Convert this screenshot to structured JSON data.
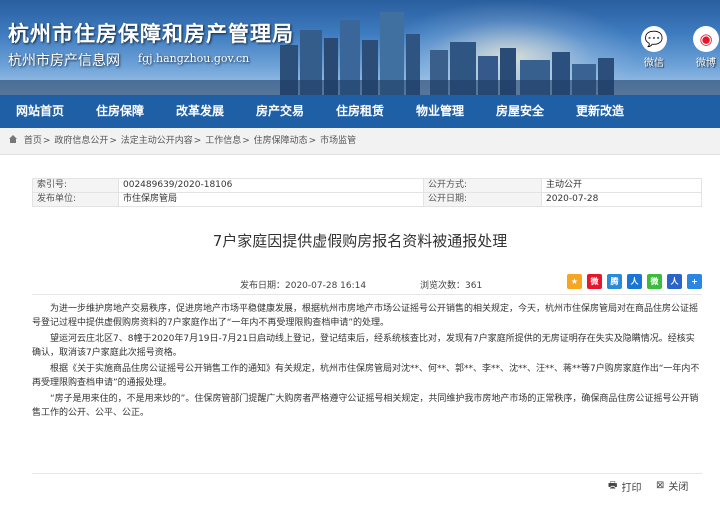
{
  "header": {
    "title": "杭州市住房保障和房产管理局",
    "subtitle": "杭州市房产信息网",
    "url": "fgj.hangzhou.gov.cn",
    "social": [
      {
        "label": "微信",
        "icon": "wechat-icon"
      },
      {
        "label": "微博",
        "icon": "weibo-icon"
      }
    ]
  },
  "nav": {
    "items": [
      "网站首页",
      "住房保障",
      "改革发展",
      "房产交易",
      "住房租赁",
      "物业管理",
      "房屋安全",
      "更新改造"
    ]
  },
  "breadcrumb": [
    "首页",
    "政府信息公开",
    "法定主动公开内容",
    "工作信息",
    "住房保障动态",
    "市场监管"
  ],
  "meta": {
    "index_label": "索引号:",
    "index_value": "002489639/2020-18106",
    "method_label": "公开方式:",
    "method_value": "主动公开",
    "publisher_label": "发布单位:",
    "publisher_value": "市住保房管局",
    "date_label": "公开日期:",
    "date_value": "2020-07-28"
  },
  "article": {
    "title": "7户家庭因提供虚假购房报名资料被通报处理",
    "publish_time": "发布日期：2020-07-28 16:14",
    "views": "浏览次数：361",
    "paragraphs": [
      "为进一步维护房地产交易秩序，促进房地产市场平稳健康发展，根据杭州市房地产市场公证摇号公开销售的相关规定，今天，杭州市住保房管局对在商品住房公证摇号登记过程中提供虚假购房资料的7户家庭作出了“一年内不再受理限购查档申请”的处理。",
      "望运河云庄北区7、8幢于2020年7月19日-7月21日启动线上登记，登记结束后，经系统核查比对，发现有7户家庭所提供的无房证明存在失实及隐瞒情况。经核实确认，取消该7户家庭此次摇号资格。",
      "根据《关于实施商品住房公证摇号公开销售工作的通知》有关规定，杭州市住保房管局对沈**、何**、郭**、李**、沈**、汪**、蒋**等7户购房家庭作出“一年内不再受理限购查档申请”的通报处理。",
      "“房子是用来住的，不是用来炒的”。住保房管部门提醒广大购房者严格遵守公证摇号相关规定，共同维护我市房地产市场的正常秩序，确保商品住房公证摇号公开销售工作的公开、公平、公正。"
    ]
  },
  "footer": {
    "print_label": "打印",
    "close_label": "关闭"
  },
  "share": [
    {
      "icon": "qzone-icon",
      "color": "#f5a623",
      "glyph": "★"
    },
    {
      "icon": "weibo-share-icon",
      "color": "#e6162d",
      "glyph": "微"
    },
    {
      "icon": "tencent-weibo-icon",
      "color": "#2b8ad8",
      "glyph": "腾"
    },
    {
      "icon": "renren-icon",
      "color": "#1976d2",
      "glyph": "人"
    },
    {
      "icon": "wechat-share-icon",
      "color": "#3dbb3d",
      "glyph": "微"
    },
    {
      "icon": "people-icon",
      "color": "#2a63c9",
      "glyph": "人"
    },
    {
      "icon": "more-share-icon",
      "color": "#2a86e0",
      "glyph": "+"
    }
  ]
}
